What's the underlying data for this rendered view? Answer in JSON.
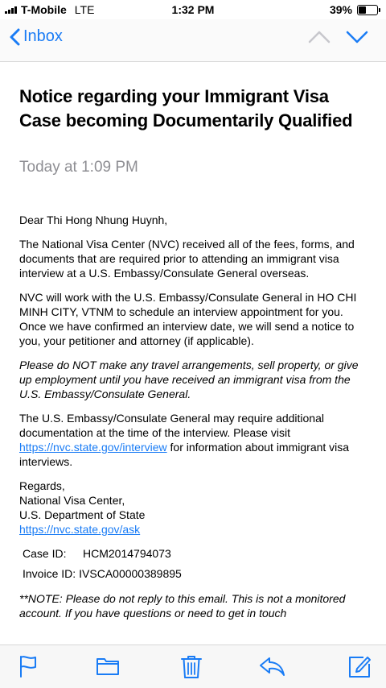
{
  "status_bar": {
    "carrier": "T-Mobile",
    "network": "LTE",
    "time": "1:32 PM",
    "battery": "39%"
  },
  "nav": {
    "back_label": "Inbox"
  },
  "email": {
    "subject": "Notice regarding your Immigrant Visa Case becoming Documentarily Qualified",
    "date": "Today at 1:09 PM",
    "greeting": "Dear Thi Hong Nhung Huynh,",
    "para1": "The National Visa Center (NVC) received all of the fees, forms, and documents that are required prior to attending an immigrant visa interview at a U.S. Embassy/Consulate General overseas.",
    "para2": "NVC will work with the U.S. Embassy/Consulate General in HO CHI MINH CITY, VTNM to schedule an interview appointment for you. Once we have confirmed an interview date, we will send a notice to you, your petitioner and attorney (if applicable).",
    "para3": "Please do NOT make any travel arrangements, sell property, or give up employment until you have received an immigrant visa from the U.S. Embassy/Consulate General.",
    "para4_before": "The U.S. Embassy/Consulate General may require additional documentation at the time of the interview. Please visit ",
    "para4_link": "https://nvc.state.gov/interview",
    "para4_after": " for information about immigrant visa interviews.",
    "regards": "Regards,",
    "sender_name": "National Visa Center,",
    "sender_org": "U.S. Department of State",
    "sender_link": "https://nvc.state.gov/ask",
    "case_label": "Case ID:",
    "case_value": "HCM2014794073",
    "invoice_label": "Invoice ID:",
    "invoice_value": "IVSCA00000389895",
    "note": "**NOTE: Please do not reply to this email. This is not a monitored account. If you have questions or need to get in touch"
  },
  "colors": {
    "accent": "#1a7cf5",
    "date_gray": "#8e8e93"
  },
  "toolbar": {
    "icons": [
      "flag-icon",
      "folder-icon",
      "trash-icon",
      "reply-icon",
      "compose-icon"
    ]
  }
}
